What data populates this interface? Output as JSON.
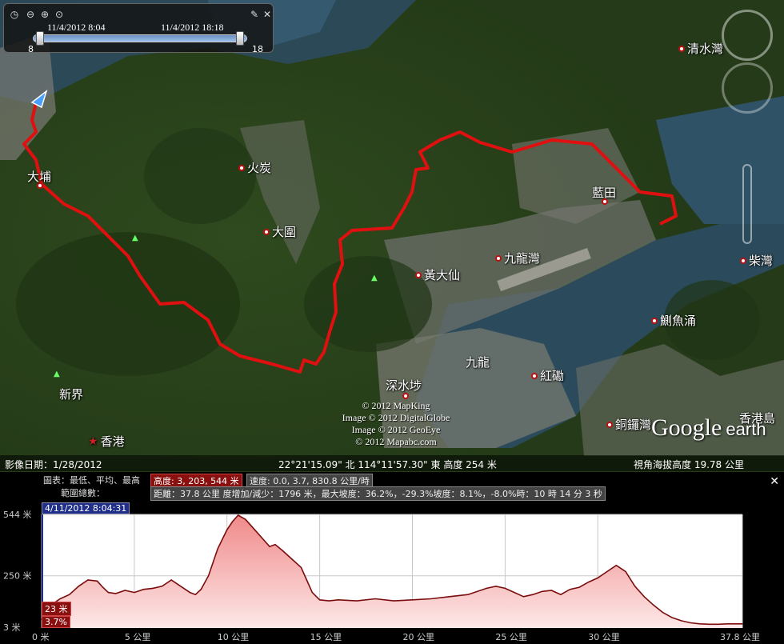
{
  "time_slider": {
    "start": "11/4/2012   8:04",
    "end": "11/4/2012   18:18",
    "min_label": "8",
    "max_label": "18"
  },
  "places": [
    {
      "id": "tai-po",
      "name": "大埔",
      "dot": true
    },
    {
      "id": "fo-tan",
      "name": "火炭",
      "dot": true
    },
    {
      "id": "tai-wai",
      "name": "大圍",
      "dot": true
    },
    {
      "id": "wong-tai-sin",
      "name": "黃大仙",
      "dot": true
    },
    {
      "id": "kowloon-bay",
      "name": "九龍灣",
      "dot": true
    },
    {
      "id": "lam-tin",
      "name": "藍田",
      "dot": true
    },
    {
      "id": "chai-wan",
      "name": "柴灣",
      "dot": true
    },
    {
      "id": "clear-water-bay",
      "name": "清水灣",
      "dot": true
    },
    {
      "id": "quarry-bay",
      "name": "鰂魚涌",
      "dot": true
    },
    {
      "id": "hung-hom",
      "name": "紅磡",
      "dot": true
    },
    {
      "id": "kowloon",
      "name": "九龍",
      "dot": false
    },
    {
      "id": "sham-shui-po",
      "name": "深水埗",
      "dot": true
    },
    {
      "id": "new-territories",
      "name": "新界",
      "dot": false
    },
    {
      "id": "hong-kong",
      "name": "香港",
      "dot": false
    },
    {
      "id": "causeway-bay",
      "name": "銅鑼灣",
      "dot": true
    },
    {
      "id": "hong-kong-island",
      "name": "香港島",
      "dot": false
    }
  ],
  "credits": [
    "© 2012 MapKing",
    "Image © 2012 DigitalGlobe",
    "Image © 2012 GeoEye",
    "© 2012 Mapabc.com"
  ],
  "logo": {
    "google": "Google",
    "earth": "earth"
  },
  "status": {
    "imagery_date": "影像日期：1/28/2012",
    "coords": "22°21'15.09\" 北 114°11'57.30\" 東 高度  254 米",
    "eye_alt": "視角海拔高度    19.78 公里"
  },
  "profile": {
    "legend_prefix": "圖表：最低、平均、最高",
    "elev_box": "高度: 3, 203, 544 米",
    "speed_box": "速度: 0.0, 3.7, 830.8 公里/時",
    "summary_prefix": "範圍總數：",
    "summary_box": "距離：37.8 公里 度增加/減少：1796 米，最大坡度：36.2%，-29.3%坡度：8.1%，-8.0%時：10 時 14 分 3 秒",
    "time_cursor": "4/11/2012 8:04:31",
    "cursor_elev": "23 米",
    "cursor_slope": "3.7%",
    "close": "✕"
  },
  "chart_data": {
    "type": "area",
    "title": "",
    "xlabel": "",
    "ylabel": "",
    "y_ticks": [
      {
        "v": 3,
        "label": "3 米"
      },
      {
        "v": 250,
        "label": "250 米"
      },
      {
        "v": 544,
        "label": "544 米"
      }
    ],
    "x_ticks": [
      {
        "v": 0,
        "label": "0 米"
      },
      {
        "v": 5,
        "label": "5 公里"
      },
      {
        "v": 10,
        "label": "10 公里"
      },
      {
        "v": 15,
        "label": "15 公里"
      },
      {
        "v": 20,
        "label": "20 公里"
      },
      {
        "v": 25,
        "label": "25 公里"
      },
      {
        "v": 30,
        "label": "30 公里"
      },
      {
        "v": 37.8,
        "label": "37.8 公里"
      }
    ],
    "xlim": [
      0,
      37.8
    ],
    "ylim": [
      0,
      544
    ],
    "grid": true,
    "x": [
      0,
      0.5,
      1,
      1.5,
      2,
      2.5,
      3,
      3.3,
      3.6,
      4,
      4.5,
      5,
      5.5,
      6,
      6.5,
      7,
      7.5,
      8,
      8.3,
      8.6,
      9,
      9.5,
      10,
      10.3,
      10.6,
      11,
      11.5,
      12,
      12.3,
      12.6,
      13,
      13.5,
      14,
      14.3,
      14.6,
      15,
      15.5,
      16,
      17,
      18,
      19,
      20,
      21,
      22,
      23,
      24,
      24.5,
      25,
      25.5,
      26,
      26.5,
      27,
      27.5,
      28,
      28.5,
      29,
      29.5,
      30,
      30.5,
      31,
      31.5,
      32,
      32.5,
      33,
      33.5,
      34,
      34.5,
      35,
      35.5,
      36,
      36.5,
      37,
      37.8
    ],
    "elevation": [
      40,
      110,
      140,
      160,
      200,
      230,
      225,
      195,
      170,
      165,
      180,
      170,
      185,
      190,
      200,
      230,
      200,
      170,
      160,
      185,
      250,
      380,
      470,
      510,
      540,
      520,
      470,
      420,
      390,
      400,
      370,
      330,
      290,
      230,
      170,
      135,
      130,
      135,
      130,
      140,
      130,
      135,
      140,
      150,
      160,
      190,
      200,
      190,
      170,
      150,
      160,
      175,
      180,
      160,
      185,
      195,
      220,
      240,
      270,
      300,
      270,
      200,
      150,
      110,
      75,
      50,
      35,
      25,
      20,
      18,
      18,
      20,
      20
    ]
  }
}
